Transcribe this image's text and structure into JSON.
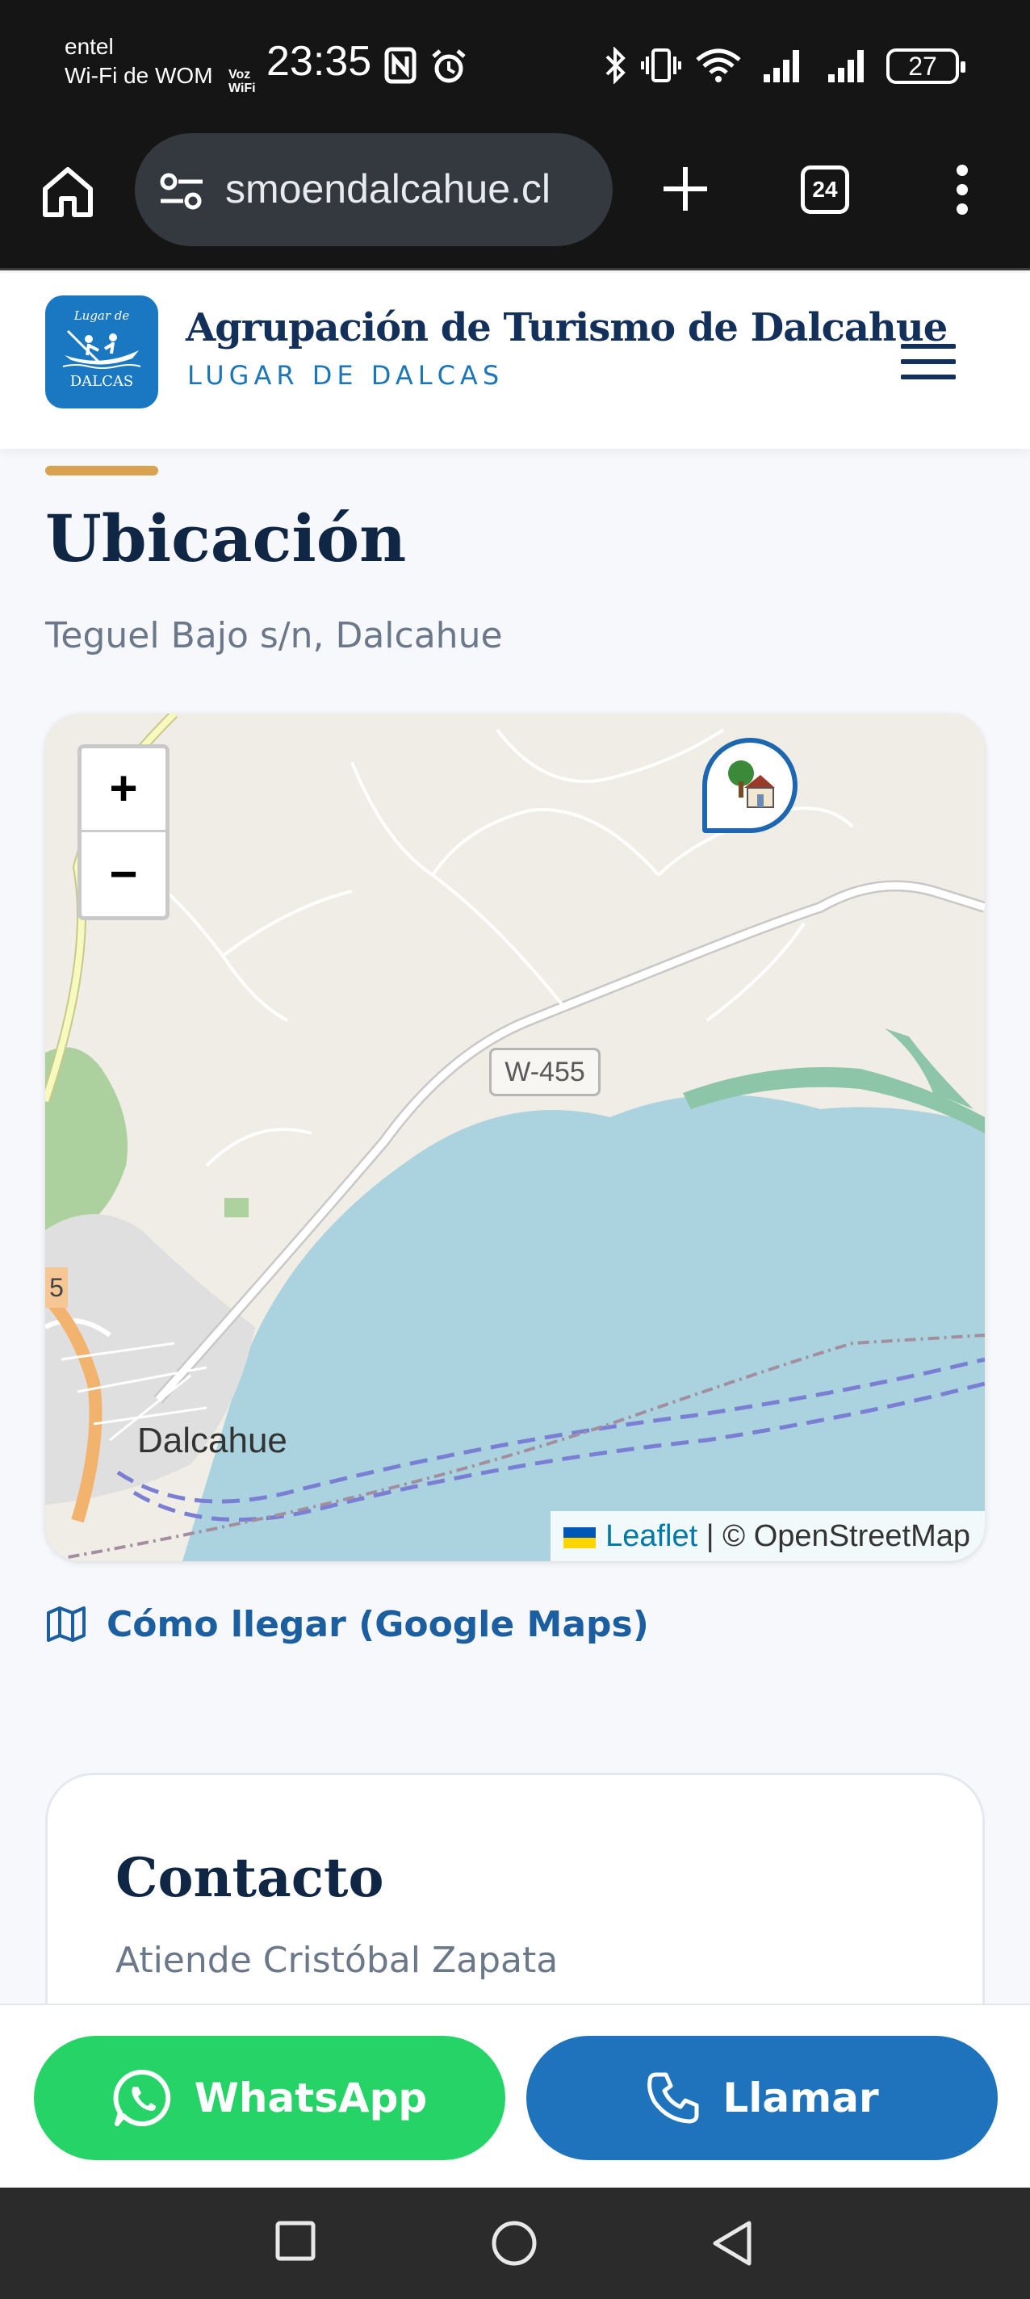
{
  "status_bar": {
    "carrier_line1": "entel",
    "carrier_line2": "Wi-Fi de WOM",
    "voz_line1": "Voz",
    "voz_line2": "WiFi",
    "time": "23:35",
    "battery": "27",
    "icons": [
      "nfc-icon",
      "alarm-icon",
      "bluetooth-icon",
      "vibrate-icon",
      "wifi-icon",
      "signal-icon",
      "signal-icon"
    ]
  },
  "browser": {
    "url": "smoendalcahue.cl",
    "tab_count": "24"
  },
  "header": {
    "logo_top": "Lugar de",
    "logo_bottom": "DALCAS",
    "title": "Agrupación de Turismo de Dalcahue",
    "subtitle": "LUGAR DE DALCAS"
  },
  "location": {
    "title": "Ubicación",
    "address": "Teguel Bajo s/n, Dalcahue"
  },
  "map": {
    "zoom_in": "+",
    "zoom_out": "−",
    "road_label": "W-455",
    "town_label": "Dalcahue",
    "edge_label": "5",
    "attribution_leaflet": "Leaflet",
    "attribution_rest": "| © OpenStreetMap",
    "colors": {
      "water": "#aad3df",
      "land": "#f0ede6",
      "road": "#ffffff",
      "wood": "#add19e",
      "marker": "#1d67b0"
    }
  },
  "directions": {
    "label": "Cómo llegar (Google Maps)"
  },
  "contact": {
    "title": "Contacto",
    "subtitle": "Atiende Cristóbal Zapata"
  },
  "actions": {
    "whatsapp": "WhatsApp",
    "call": "Llamar",
    "colors": {
      "whatsapp": "#25d366",
      "call": "#1f73bd"
    }
  }
}
